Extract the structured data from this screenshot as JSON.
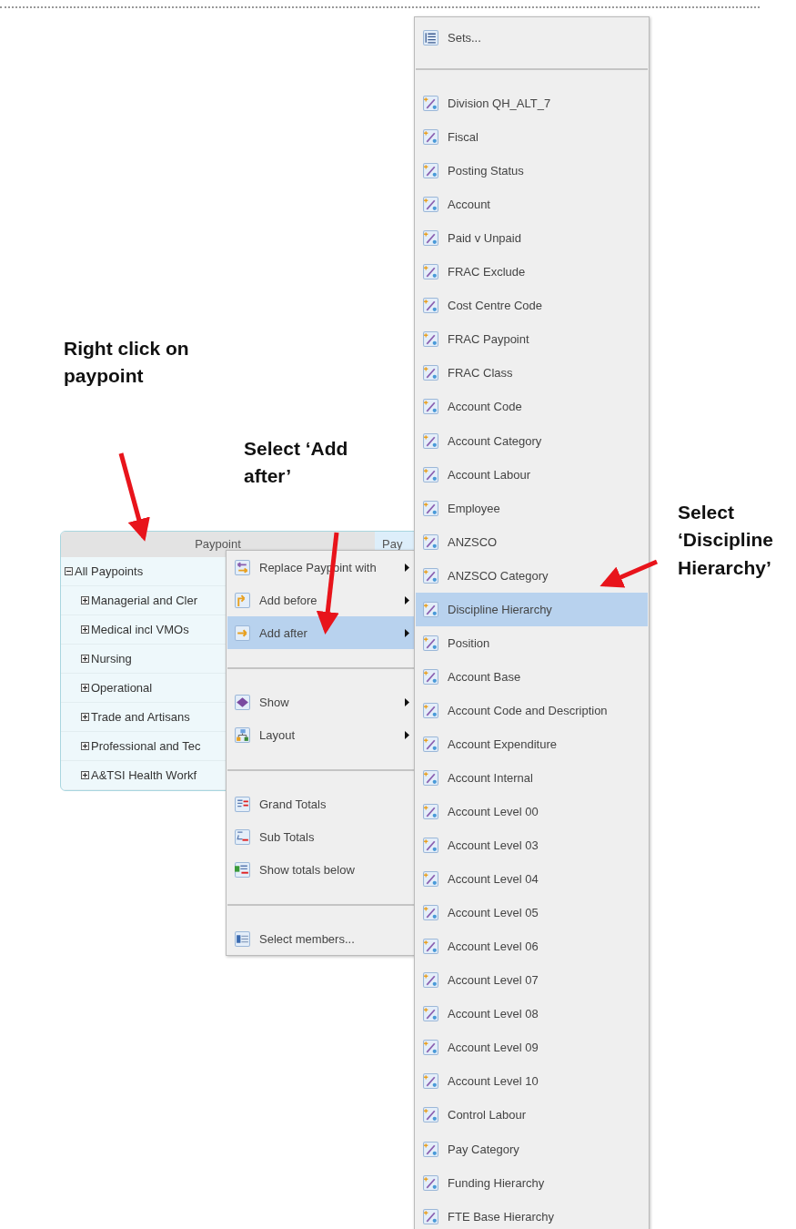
{
  "annotations": [
    {
      "text": "Right click on paypoint"
    },
    {
      "text": "Select ‘Add after’"
    },
    {
      "text": "Select ‘Discipline Hierarchy’"
    }
  ],
  "table": {
    "columns": [
      "Paypoint",
      "Pay"
    ],
    "rows": [
      {
        "label": "All Paypoints",
        "expanded": true,
        "children": [
          {
            "label": "Managerial and Cler",
            "expanded": false
          },
          {
            "label": "Medical incl VMOs",
            "expanded": false
          },
          {
            "label": "Nursing",
            "expanded": false
          },
          {
            "label": "Operational",
            "expanded": false
          },
          {
            "label": "Trade and Artisans",
            "expanded": false
          },
          {
            "label": "Professional and Tec",
            "expanded": false
          },
          {
            "label": "A&TSI Health Workf",
            "expanded": false
          }
        ]
      }
    ]
  },
  "context_menu": {
    "groups": [
      [
        {
          "label": "Replace Paypoint with",
          "submenu": true,
          "selected": false
        },
        {
          "label": "Add before",
          "submenu": true,
          "selected": false
        },
        {
          "label": "Add after",
          "submenu": true,
          "selected": true
        }
      ],
      [
        {
          "label": "Show",
          "submenu": true,
          "selected": false
        },
        {
          "label": "Layout",
          "submenu": true,
          "selected": false
        }
      ],
      [
        {
          "label": "Grand Totals",
          "submenu": false,
          "selected": false
        },
        {
          "label": "Sub Totals",
          "submenu": false,
          "selected": false
        },
        {
          "label": "Show totals below",
          "submenu": false,
          "selected": false
        }
      ],
      [
        {
          "label": "Select members...",
          "submenu": false,
          "selected": false
        }
      ]
    ]
  },
  "submenu": {
    "groups": [
      [
        {
          "label": "Sets...",
          "selected": false
        }
      ],
      [
        {
          "label": "Division QH_ALT_7",
          "selected": false
        },
        {
          "label": "Fiscal",
          "selected": false
        },
        {
          "label": "Posting Status",
          "selected": false
        },
        {
          "label": "Account",
          "selected": false
        },
        {
          "label": "Paid v Unpaid",
          "selected": false
        },
        {
          "label": "FRAC Exclude",
          "selected": false
        },
        {
          "label": "Cost Centre Code",
          "selected": false
        },
        {
          "label": "FRAC Paypoint",
          "selected": false
        },
        {
          "label": "FRAC Class",
          "selected": false
        },
        {
          "label": "Account Code",
          "selected": false
        },
        {
          "label": "Account Category",
          "selected": false
        },
        {
          "label": "Account Labour",
          "selected": false
        },
        {
          "label": "Employee",
          "selected": false
        },
        {
          "label": "ANZSCO",
          "selected": false
        },
        {
          "label": "ANZSCO Category",
          "selected": false
        },
        {
          "label": "Discipline Hierarchy",
          "selected": true
        },
        {
          "label": "Position",
          "selected": false
        },
        {
          "label": "Account Base",
          "selected": false
        },
        {
          "label": "Account Code and Description",
          "selected": false
        },
        {
          "label": "Account Expenditure",
          "selected": false
        },
        {
          "label": "Account Internal",
          "selected": false
        },
        {
          "label": "Account Level 00",
          "selected": false
        },
        {
          "label": "Account Level 03",
          "selected": false
        },
        {
          "label": "Account Level 04",
          "selected": false
        },
        {
          "label": "Account Level 05",
          "selected": false
        },
        {
          "label": "Account Level 06",
          "selected": false
        },
        {
          "label": "Account Level 07",
          "selected": false
        },
        {
          "label": "Account Level 08",
          "selected": false
        },
        {
          "label": "Account Level 09",
          "selected": false
        },
        {
          "label": "Account Level 10",
          "selected": false
        },
        {
          "label": "Control Labour",
          "selected": false
        },
        {
          "label": "Pay Category",
          "selected": false
        },
        {
          "label": "Funding Hierarchy",
          "selected": false
        },
        {
          "label": "FTE Base Hierarchy",
          "selected": false
        }
      ]
    ]
  }
}
